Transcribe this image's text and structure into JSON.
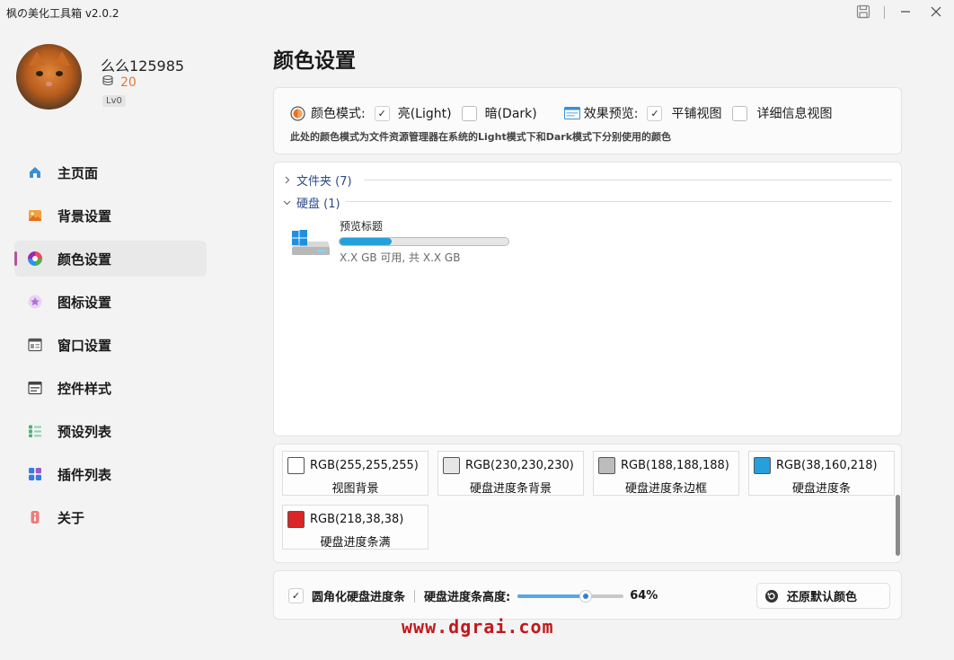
{
  "window": {
    "title": "枫の美化工具箱 v2.0.2",
    "icons": [
      "save-icon",
      "minimize-icon",
      "close-icon"
    ]
  },
  "profile": {
    "username": "么么125985",
    "coins": "20",
    "level": "Lv0"
  },
  "sidebar": {
    "items": [
      {
        "label": "主页面",
        "icon": "home-icon"
      },
      {
        "label": "背景设置",
        "icon": "image-icon"
      },
      {
        "label": "颜色设置",
        "icon": "palette-icon",
        "active": true
      },
      {
        "label": "图标设置",
        "icon": "star-icon"
      },
      {
        "label": "窗口设置",
        "icon": "window-icon"
      },
      {
        "label": "控件样式",
        "icon": "control-icon"
      },
      {
        "label": "预设列表",
        "icon": "list-icon"
      },
      {
        "label": "插件列表",
        "icon": "plugin-icon"
      },
      {
        "label": "关于",
        "icon": "info-icon"
      }
    ]
  },
  "main": {
    "title": "颜色设置",
    "options": {
      "color_mode_label": "颜色模式:",
      "light_label": "亮(Light)",
      "light_checked": true,
      "dark_label": "暗(Dark)",
      "dark_checked": false,
      "preview_label": "效果预览:",
      "tile_view_label": "平铺视图",
      "tile_view_checked": true,
      "detail_view_label": "详细信息视图",
      "detail_view_checked": false,
      "hint": "此处的颜色模式为文件资源管理器在系统的Light模式下和Dark模式下分别使用的颜色"
    },
    "preview": {
      "folder_group": "文件夹 (7)",
      "disk_group": "硬盘 (1)",
      "drive_title": "预览标题",
      "drive_sub": "X.X GB 可用, 共 X.X GB",
      "drive_progress": 0.31
    },
    "swatches": [
      {
        "rgb": "RGB(255,255,255)",
        "label": "视图背景",
        "color": "#ffffff"
      },
      {
        "rgb": "RGB(230,230,230)",
        "label": "硬盘进度条背景",
        "color": "#e6e6e6"
      },
      {
        "rgb": "RGB(188,188,188)",
        "label": "硬盘进度条边框",
        "color": "#bcbcbc"
      },
      {
        "rgb": "RGB(38,160,218)",
        "label": "硬盘进度条",
        "color": "#26a0da"
      },
      {
        "rgb": "RGB(218,38,38)",
        "label": "硬盘进度条满",
        "color": "#da2626"
      }
    ],
    "bottom": {
      "rounded_label": "圆角化硬盘进度条",
      "rounded_checked": true,
      "height_label": "硬盘进度条高度:",
      "height_value": "64%",
      "height_fraction": 0.64,
      "restore_label": "还原默认颜色"
    }
  },
  "watermark": "www.dgrai.com"
}
